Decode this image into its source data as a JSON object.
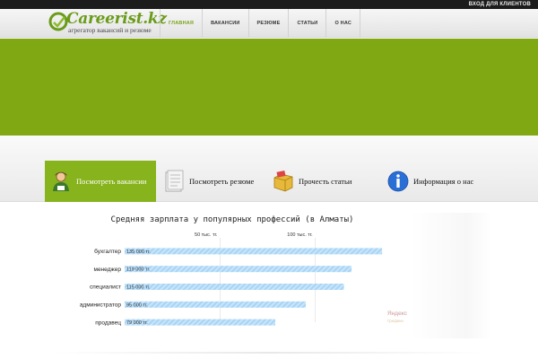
{
  "topbar": {
    "login_label": "ВХОД ДЛЯ КЛИЕНТОВ"
  },
  "logo": {
    "title": "Careerist.kz",
    "subtitle": "агрегатор вакансий и резюме"
  },
  "nav": {
    "items": [
      {
        "label": "ГЛАВНАЯ",
        "active": true
      },
      {
        "label": "ВАКАНСИИ",
        "active": false
      },
      {
        "label": "РЕЗЮМЕ",
        "active": false
      },
      {
        "label": "СТАТЬИ",
        "active": false
      },
      {
        "label": "О НАС",
        "active": false
      }
    ]
  },
  "banner": {
    "color": "#7fa812"
  },
  "tabs": [
    {
      "label": "Посмотреть вакансии",
      "icon": "person-icon",
      "active": true
    },
    {
      "label": "Посмотреть резюме",
      "icon": "document-icon",
      "active": false
    },
    {
      "label": "Прочесть статьи",
      "icon": "folder-icon",
      "active": false
    },
    {
      "label": "Информация о нас",
      "icon": "info-icon",
      "active": false
    }
  ],
  "chart_data": {
    "type": "bar",
    "title": "Средняя зарплата у популярных профессий (в Алматы)",
    "categories": [
      "бухгалтер",
      "менеджер",
      "специалист",
      "администратор",
      "продавец"
    ],
    "values": [
      135000,
      119000,
      115000,
      95000,
      79000
    ],
    "value_labels": [
      "135 000 тг.",
      "119 000 тг.",
      "115 000 тг.",
      "95 000 тг.",
      "79 000 тг."
    ],
    "ticks": [
      50000,
      100000
    ],
    "tick_labels": [
      "50 тыс. тг.",
      "100 тыс. тг."
    ],
    "xlim": [
      0,
      150000
    ],
    "grid": true,
    "bar_color": "#a8d4f5"
  },
  "watermark": {
    "main": "Яндекс",
    "sub": "Графики"
  }
}
